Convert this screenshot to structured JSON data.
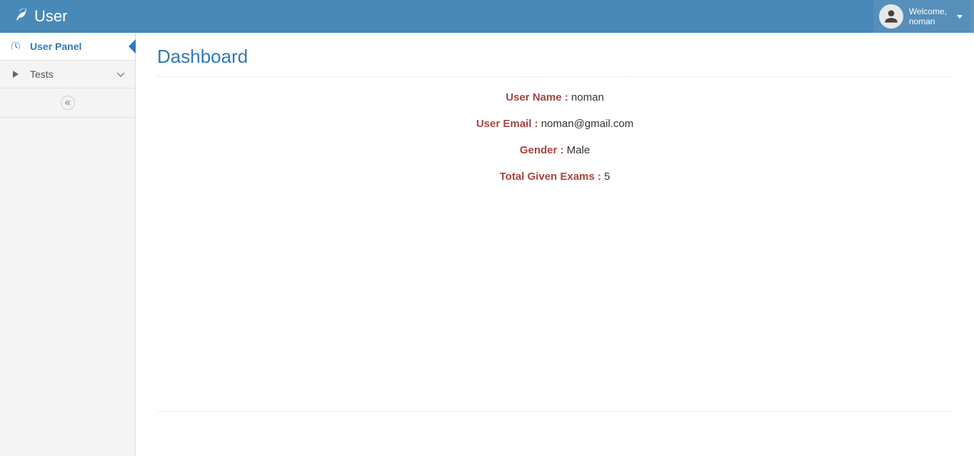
{
  "header": {
    "brand": "User",
    "welcome_label": "Welcome,",
    "username": "noman"
  },
  "sidebar": {
    "items": [
      {
        "label": "User Panel",
        "icon": "dashboard-icon",
        "active": true
      },
      {
        "label": "Tests",
        "icon": "caret-right-icon",
        "active": false,
        "expandable": true
      }
    ]
  },
  "main": {
    "title": "Dashboard",
    "fields": [
      {
        "key": "User Name :",
        "value": " noman"
      },
      {
        "key": "User Email :",
        "value": " noman@gmail.com"
      },
      {
        "key": "Gender :",
        "value": " Male"
      },
      {
        "key": "Total Given Exams :",
        "value": " 5"
      }
    ]
  }
}
